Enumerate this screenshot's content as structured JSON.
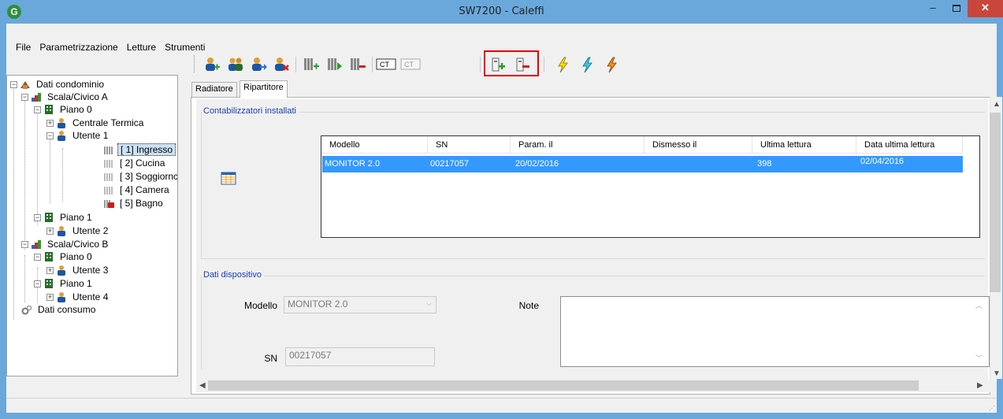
{
  "window": {
    "title": "SW7200 - Caleffi",
    "app_icon": "G",
    "minimize": "–",
    "close": "✕"
  },
  "menu": [
    "File",
    "Parametrizzazione",
    "Letture",
    "Strumenti"
  ],
  "toolbar": {
    "ct_on_label": "CT",
    "ct_off_label": "CT",
    "buttons": [
      "add-user-icon",
      "users-icon",
      "move-user-icon",
      "remove-user-icon",
      "add-radiator-icon",
      "radiator-next-icon",
      "remove-radiator-icon",
      "ct-on-icon",
      "ct-off-icon",
      "install-device-icon",
      "uninstall-device-icon",
      "flash-yellow-icon",
      "flash-blue-icon",
      "flash-orange-icon"
    ]
  },
  "tree": {
    "root": "Dati condominio",
    "scala_a": "Scala/Civico A",
    "piano_0_a": "Piano  0",
    "centrale": "Centrale Termica",
    "utente1": "Utente 1",
    "rooms": [
      "[ 1] Ingresso",
      "[ 2] Cucina",
      "[ 3] Soggiornc",
      "[ 4] Camera",
      "[ 5] Bagno"
    ],
    "piano_1_a": "Piano  1",
    "utente2": "Utente 2",
    "scala_b": "Scala/Civico B",
    "piano_0_b": "Piano  0",
    "utente3": "Utente 3",
    "piano_1_b": "Piano  1",
    "utente4": "Utente 4",
    "consumo": "Dati consumo"
  },
  "tabs": [
    "Radiatore",
    "Ripartitore"
  ],
  "installed": {
    "title": "Contabilizzatori installati",
    "columns": [
      "Modello",
      "SN",
      "Param. il",
      "Dismesso il",
      "Ultima lettura",
      "Data ultima lettura"
    ],
    "rows": [
      [
        "MONITOR 2.0",
        "00217057",
        "20/02/2016",
        "",
        "398",
        "02/04/2016"
      ]
    ]
  },
  "device": {
    "title": "Dati dispositivo",
    "modello_label": "Modello",
    "modello_value": "MONITOR 2.0",
    "note_label": "Note",
    "sn_label": "SN",
    "sn_value": "00217057"
  },
  "colors": {
    "titlebar": "#6aa8dc",
    "selection": "#3399ff",
    "highlight_box": "#e30000"
  }
}
